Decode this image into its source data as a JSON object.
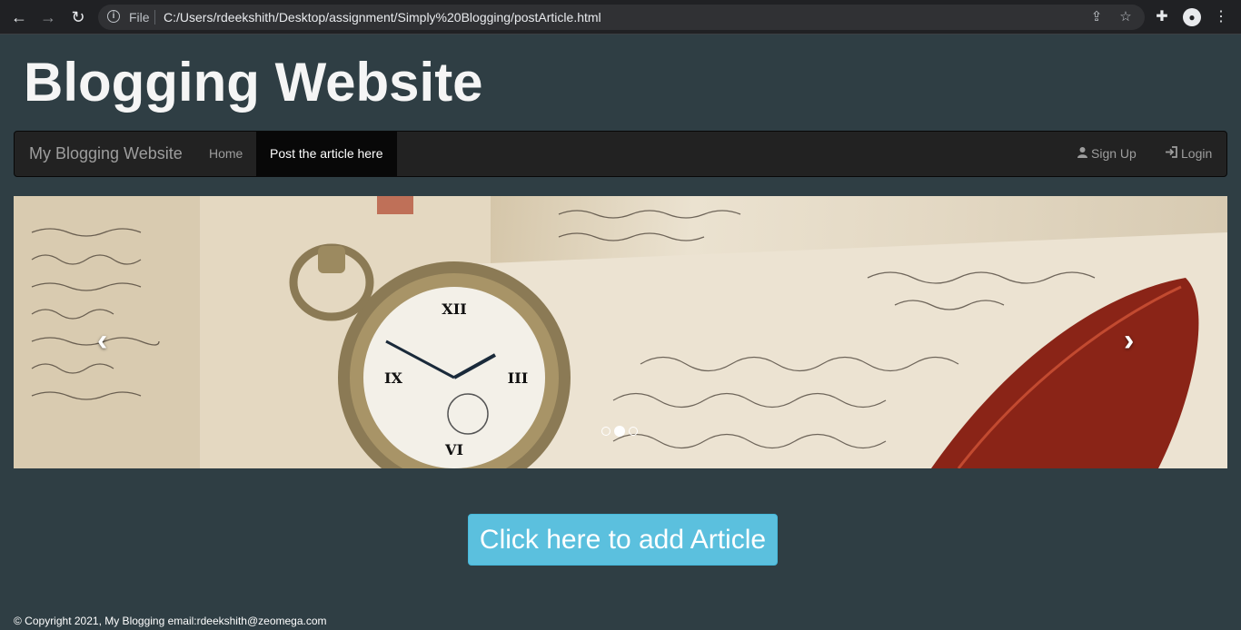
{
  "browser": {
    "scheme_label": "File",
    "url": "C:/Users/rdeekshith/Desktop/assignment/Simply%20Blogging/postArticle.html",
    "icons": [
      "back-arrow-icon",
      "forward-arrow-icon",
      "reload-icon",
      "info-icon",
      "share-icon",
      "star-icon",
      "extensions-icon",
      "profile-icon",
      "menu-icon"
    ]
  },
  "header": {
    "title": "Blogging Website"
  },
  "navbar": {
    "brand": "My Blogging Website",
    "links": [
      {
        "label": "Home",
        "active": false
      },
      {
        "label": "Post the article here",
        "active": true
      }
    ],
    "right": [
      {
        "label": "Sign Up",
        "icon": "user-icon"
      },
      {
        "label": "Login",
        "icon": "login-icon"
      }
    ]
  },
  "carousel": {
    "slide_count": 3,
    "active_slide": 2,
    "image_description": "vintage pocket watch, handwritten letters and a red quill feather",
    "prev_glyph": "‹",
    "next_glyph": "›"
  },
  "main": {
    "add_button_label": "Click here to add Article"
  },
  "footer": {
    "text": "© Copyright 2021, My Blogging email:rdeekshith@zeomega.com"
  },
  "colors": {
    "page_bg": "#2f3e44",
    "navbar_bg": "#222222",
    "button_bg": "#5bc0de"
  }
}
